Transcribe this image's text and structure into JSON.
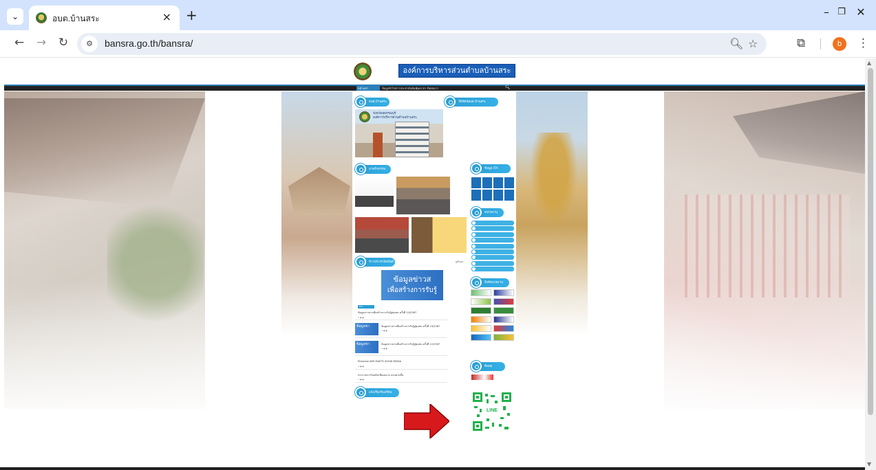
{
  "browser": {
    "tab_title": "อบต.บ้านสระ",
    "url": "bansra.go.th/bansra/",
    "profile_initial": "b",
    "icons": {
      "tab_list": "chevron-down-icon",
      "close": "close-icon",
      "new_tab": "plus-icon",
      "back": "arrow-left-icon",
      "forward": "arrow-right-icon",
      "reload": "reload-icon",
      "site_info": "tune-icon",
      "zoom": "zoom-icon",
      "bookmark": "star-icon",
      "extensions": "puzzle-icon",
      "menu": "kebab-menu-icon"
    }
  },
  "site": {
    "banner_title": "องค์การบริหารส่วนตำบลบ้านสระ",
    "nav": [
      "หน้าแรก",
      "ข้อมูลทั่วไป",
      "ข่าวประชาสัมพันธ์",
      "บุคลากร",
      "ติดต่อเรา"
    ],
    "sections": {
      "about": "อบต.บ้านสระ",
      "video": "วีดีทัศน์อบต.บ้านสระ",
      "activities": "ภาพกิจกรรม",
      "stats": "ข้อมูล ITA",
      "links": "หน่วยงาน",
      "news": "ข่าวประชาสัมพันธ์",
      "partners": "ลิงค์หน่วยงาน",
      "contact": "ติดต่อ",
      "complaint": "แจ้งเรื่องร้องเรียน"
    },
    "hero_text": [
      "จังหวัดสุพรรณบุรี",
      "องค์การบริหารส่วนตำบลบ้านสระ"
    ],
    "info_banner": [
      "ข้อมูลข่าวส",
      "เพื่อสร้างการรับรู้"
    ],
    "news_tag": "ข่าวประชาสัมพันธ์",
    "news_items": [
      "ข้อมูลข่าวสารเพื่อสร้างการรับรู้สู่ชุมชน ครั้งที่ 14/2567",
      "ข้อมูลข่าวสารเพื่อสร้างการรับรู้สู่ชุมชน ครั้งที่ 13/2567",
      "ข้อมูลข่าวสารเพื่อสร้างการรับรู้สู่ชุมชน ครั้งที่ 12/2567",
      "Pinterest WiFi MAETE SHOW MEDIA",
      "ประกาศการรับสมัครชื่อผลงาน ครบตามขั้น"
    ],
    "more_link": "ดูทั้งหมด",
    "qr_label": "LINE",
    "arrow_color": "#d7191c",
    "accent_color": "#2a9fd6"
  }
}
